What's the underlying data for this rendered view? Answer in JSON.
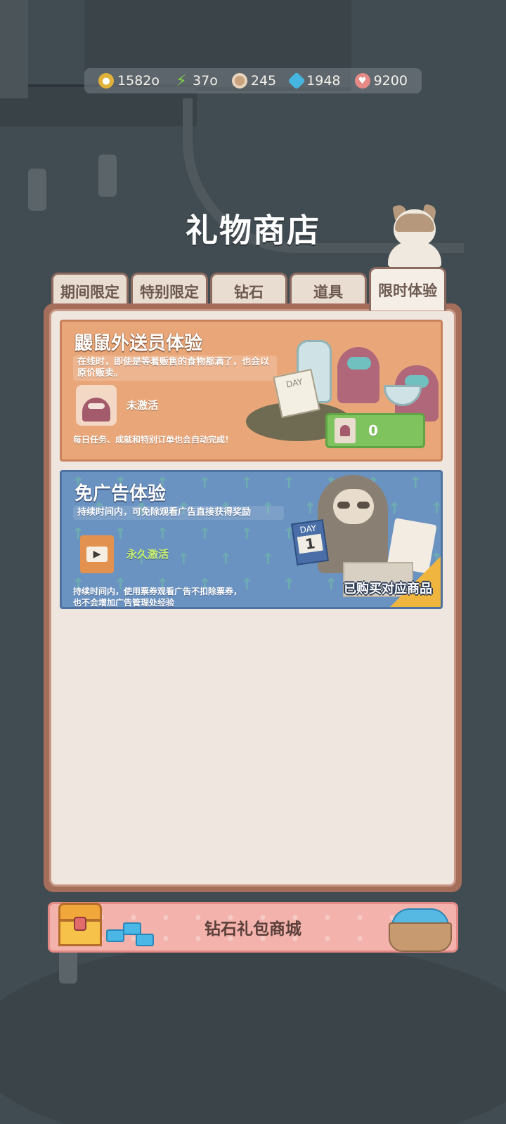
{
  "resources": [
    {
      "icon": "coin-icon",
      "value": "1582o"
    },
    {
      "icon": "energy-icon",
      "value": "37o"
    },
    {
      "icon": "donut-icon",
      "value": "245"
    },
    {
      "icon": "diamond-icon",
      "value": "1948"
    },
    {
      "icon": "heart-icon",
      "value": "9200"
    }
  ],
  "title": "礼物商店",
  "tabs": [
    {
      "label": "期间限定",
      "active": false
    },
    {
      "label": "特别限定",
      "active": false
    },
    {
      "label": "钻石",
      "active": false
    },
    {
      "label": "道具",
      "active": false
    },
    {
      "label": "限时体验",
      "active": true
    }
  ],
  "card1": {
    "title": "鼹鼠外送员体验",
    "desc": "在线时，即使是等着贩售的食物都满了，也会以原价贩卖。",
    "status": "未激活",
    "foot": "每日任务、成就和特别订单也会自动完成！",
    "day_label": "DAY",
    "count": "0"
  },
  "card2": {
    "title": "免广告体验",
    "desc": "持续时间内，可免除观看广告直接获得奖励",
    "status": "永久激活",
    "foot": "持续时间内，使用票券观看广告不扣除票券，也不会增加广告管理处经验",
    "day_label": "DAY",
    "day_number": "1",
    "purchased": "已购买对应商品"
  },
  "shop_button": "钻石礼包商城",
  "colors": {
    "card1_bg": "#e9a779",
    "card2_bg": "#6b93c2",
    "panel_frame": "#a56e5a",
    "active_status": "#c9f16f",
    "count_green": "#7fc35e"
  }
}
